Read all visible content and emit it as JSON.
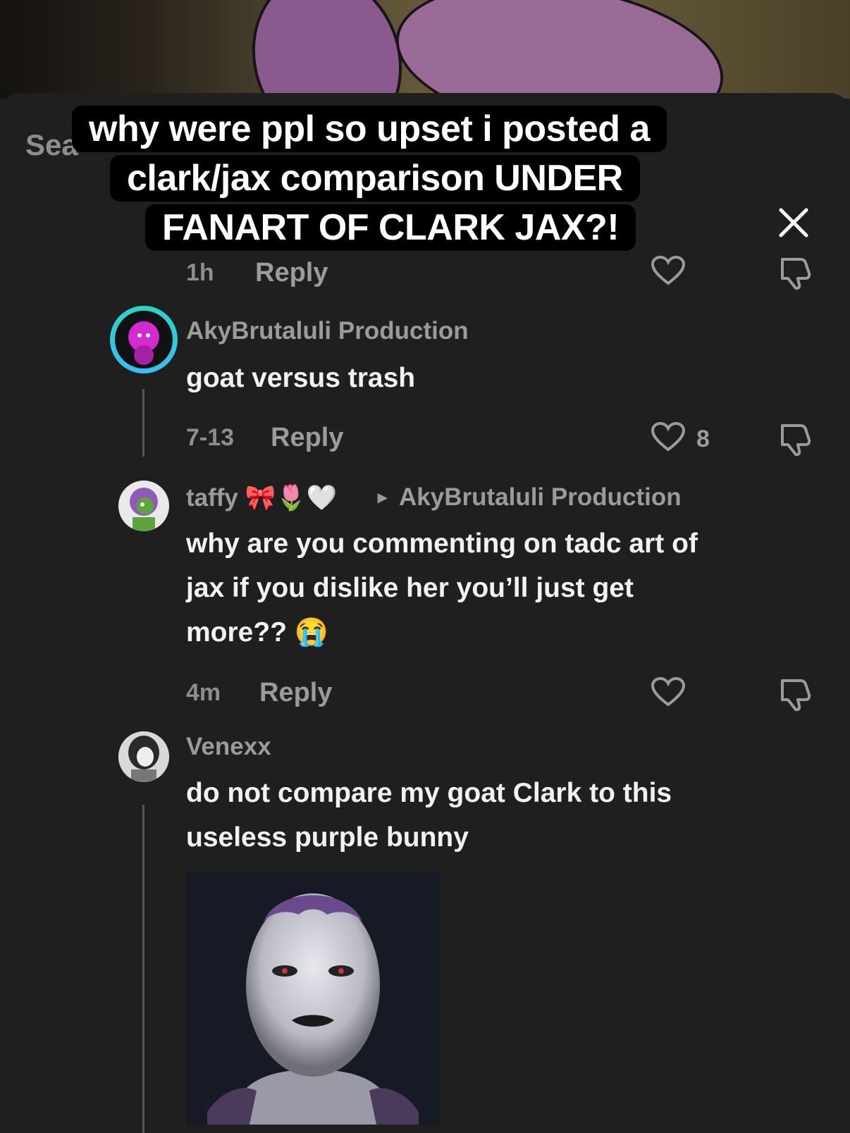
{
  "caption": {
    "line1": "why were ppl so upset i posted a",
    "line2": "clark/jax comparison UNDER",
    "line3": "FANART OF CLARK JAX?!"
  },
  "header": {
    "search_stub": "Sea",
    "close_icon": "close-icon"
  },
  "partial_comment": {
    "time": "1h",
    "reply_label": "Reply"
  },
  "comments": [
    {
      "username": "AkyBrutaluli Production",
      "text": "goat versus trash",
      "time": "7-13",
      "reply_label": "Reply",
      "likes": "8"
    },
    {
      "username": "taffy 🎀🌷🤍",
      "reply_to_arrow": "▸",
      "reply_to": "AkyBrutaluli Production",
      "text_line1": "why are you commenting on tadc art of",
      "text_line2": "jax if you dislike her you’ll just get",
      "text_line3": "more?? 😭",
      "time": "4m",
      "reply_label": "Reply"
    },
    {
      "username": "Venexx",
      "text_line1": "do not compare my goat Clark to this",
      "text_line2": "useless purple bunny"
    }
  ],
  "colors": {
    "background": "#1f1f1f",
    "username_gray": "#9b9b9b",
    "caption_bg": "#000000"
  }
}
